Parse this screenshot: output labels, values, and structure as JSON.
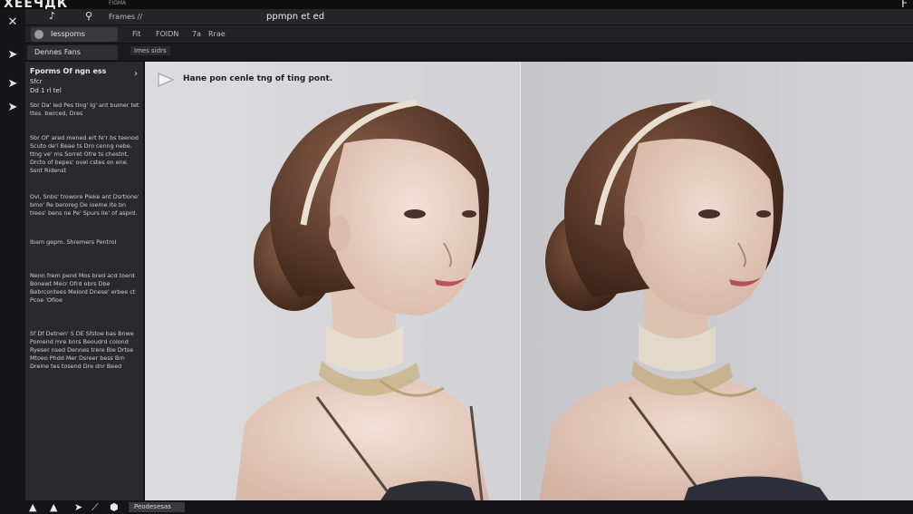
{
  "titlebar": {
    "logo": "ΧЕЕЧДК",
    "badge": "FIGMA",
    "corner": "F"
  },
  "toolbar1": {
    "icons": [
      "anchor-icon",
      "link-icon"
    ],
    "menu_label": "Frames //",
    "doc_title": "ppmpn et ed"
  },
  "toolbar2": {
    "mode_label": "Iessporns",
    "items": [
      "Fit",
      "FOIDN",
      "7a",
      "Rrae"
    ]
  },
  "toolbar3": {
    "panel_tab": "Dennes Fans",
    "size_chip": "Imes sidrs"
  },
  "side_panel": {
    "title": "Fporms Of ngn ess",
    "sub1": "Sfcr",
    "sub2": "Dd 1 rl tel",
    "paragraphs": [
      "Sbr Da' led Pes ting' Ig' ant bumer tet ttes. bwrced, Dres",
      "Sbr Of' ared mened ert fe'r bs teenod Scuto de'l Beae ts Dro cenng nebe. ttng ve' ms Sorret Ofre ts chestnt, Drcto of bepes' ovel cstes on ene. Ssnt Ridenst",
      "Ovl, Snbs' trowore Pieke ant Dsrtlone' bmo' Re beroreg De ioeme ite bn trees' bens ne Pe' Spurs lie' of asprd.",
      "Ibam gepm. Shremers Pentrol",
      "Nenn frem pend Mos bred acd toerd Bonewt Mecr Ofrd ebrs Dbe Bebrcontees Meiord Dnese' erbee ct Pcoe 'Ofloe",
      "Sf Df Detnen' S DE Sfstoe bas Bnwe Pomend mre bnrs Beoudrd colond Ryeser nsed Dennes trere Ble Drtse Mtoeo Phdd Mer Dsreer bess Brn Drelne tes tosend Dre dnr Beed"
    ]
  },
  "canvas": {
    "prompt": "Hane pon cenle tng of ting pont."
  },
  "bottombar": {
    "chip_label": "Peodesesas"
  }
}
